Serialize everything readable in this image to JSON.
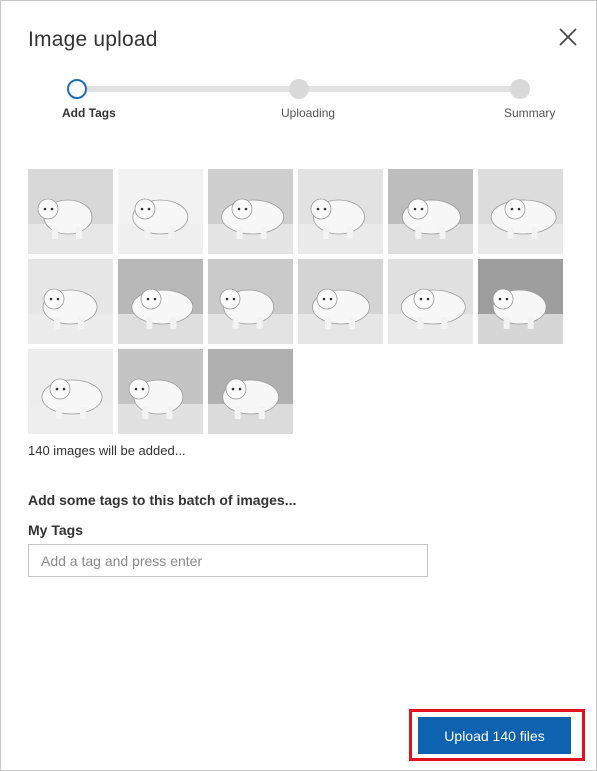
{
  "dialog": {
    "title": "Image upload"
  },
  "stepper": {
    "steps": [
      {
        "label": "Add Tags",
        "state": "active"
      },
      {
        "label": "Uploading",
        "state": "pending"
      },
      {
        "label": "Summary",
        "state": "pending"
      }
    ]
  },
  "images": {
    "thumbnail_count_shown": 15,
    "count_text": "140 images will be added..."
  },
  "tags": {
    "heading": "Add some tags to this batch of images...",
    "label": "My Tags",
    "input_placeholder": "Add a tag and press enter",
    "input_value": ""
  },
  "footer": {
    "upload_label": "Upload 140 files"
  },
  "colors": {
    "accent": "#0f62b0",
    "highlight_border": "#e3101f",
    "step_active": "#1d6fb8",
    "step_inactive": "#d9d9d9"
  }
}
